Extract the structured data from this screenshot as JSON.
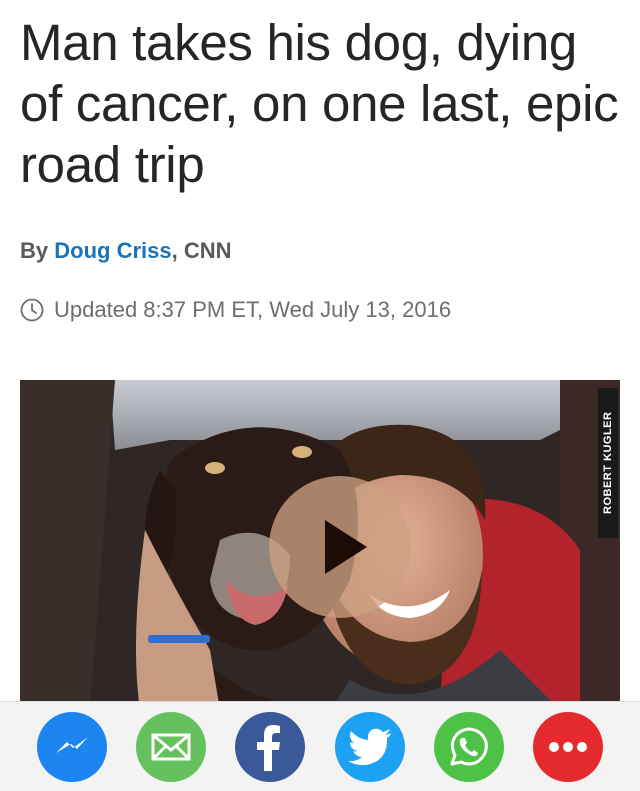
{
  "article": {
    "headline": "Man takes his dog, dying of cancer, on one last, epic road trip",
    "byline_prefix": "By ",
    "author": "Doug Criss",
    "byline_suffix": ", CNN",
    "timestamp": "Updated 8:37 PM ET, Wed July 13, 2016"
  },
  "video": {
    "photo_credit": "ROBERT KUGLER",
    "play_icon": "play-icon"
  },
  "share_bar": {
    "buttons": [
      {
        "name": "messenger",
        "icon": "messenger-icon",
        "color": "#1c85f2"
      },
      {
        "name": "email",
        "icon": "envelope-icon",
        "color": "#65c05e"
      },
      {
        "name": "facebook",
        "icon": "facebook-icon",
        "color": "#3b5998"
      },
      {
        "name": "twitter",
        "icon": "twitter-icon",
        "color": "#1da1f2"
      },
      {
        "name": "whatsapp",
        "icon": "whatsapp-icon",
        "color": "#4dc247"
      },
      {
        "name": "more",
        "icon": "more-icon",
        "color": "#e52a2e"
      }
    ]
  }
}
